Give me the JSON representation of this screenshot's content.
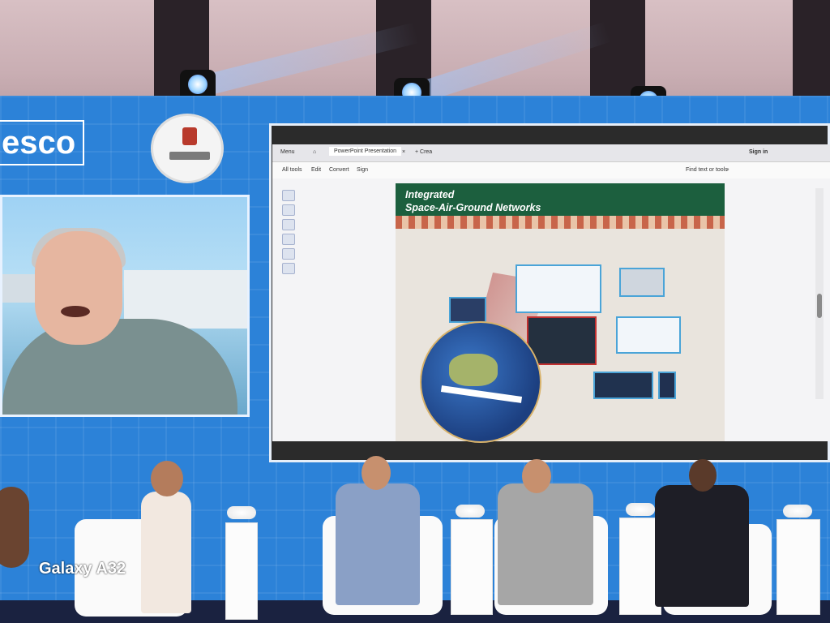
{
  "backdrop": {
    "logo_text": "esco"
  },
  "pdf_viewer": {
    "tab_menu": "Menu",
    "tab_document": "PowerPoint Presentation",
    "tab_new": "+ Crea",
    "sign_in": "Sign in",
    "find_label": "Find text or tools",
    "menu_all_tools": "All tools",
    "menu_edit": "Edit",
    "menu_convert": "Convert",
    "menu_sign": "Sign"
  },
  "slide": {
    "title_line1": "Integrated",
    "title_line2": "Space-Air-Ground Networks"
  },
  "watermark": "Galaxy A32",
  "colors": {
    "wall": "#2c82d8",
    "slide_header": "#1c5f3e",
    "stage": "#1a2240"
  }
}
